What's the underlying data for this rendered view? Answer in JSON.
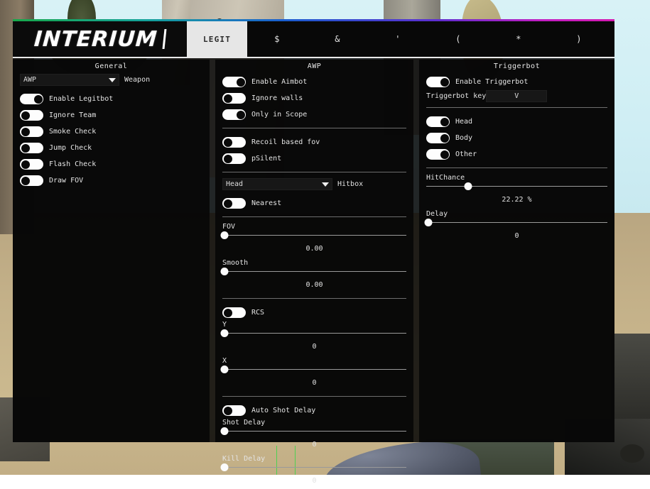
{
  "window": {
    "logo": "INTERIUM",
    "accent_gradient": [
      "#18a84a",
      "#16a39b",
      "#1a5fd0",
      "#5c2fd0",
      "#c21fc2"
    ]
  },
  "tabs": [
    {
      "label": "LEGIT",
      "active": true
    },
    {
      "label": "$",
      "active": false
    },
    {
      "label": "&",
      "active": false
    },
    {
      "label": "'",
      "active": false
    },
    {
      "label": "(",
      "active": false
    },
    {
      "label": "*",
      "active": false
    },
    {
      "label": ")",
      "active": false
    }
  ],
  "general": {
    "title": "General",
    "weapon_dropdown": {
      "value": "AWP",
      "label": "Weapon",
      "caret": "chevron-down-icon"
    },
    "toggles": [
      {
        "label": "Enable Legitbot",
        "on": true
      },
      {
        "label": "Ignore Team",
        "on": false
      },
      {
        "label": "Smoke Check",
        "on": false
      },
      {
        "label": "Jump Check",
        "on": false
      },
      {
        "label": "Flash Check",
        "on": false
      },
      {
        "label": "Draw FOV",
        "on": false
      }
    ]
  },
  "aimbot": {
    "title": "AWP",
    "toggles_top": [
      {
        "label": "Enable Aimbot",
        "on": true
      },
      {
        "label": "Ignore walls",
        "on": false
      },
      {
        "label": "Only in Scope",
        "on": true
      }
    ],
    "toggles_mid": [
      {
        "label": "Recoil based fov",
        "on": false
      },
      {
        "label": "pSilent",
        "on": false
      }
    ],
    "hitbox_dropdown": {
      "value": "Head",
      "label": "Hitbox",
      "caret": "chevron-down-icon"
    },
    "nearest_toggle": {
      "label": "Nearest",
      "on": false
    },
    "sliders_a": [
      {
        "label": "FOV",
        "value": "0.00",
        "pct": 1
      },
      {
        "label": "Smooth",
        "value": "0.00",
        "pct": 1
      }
    ],
    "rcs_toggle": {
      "label": "RCS",
      "on": false
    },
    "sliders_b": [
      {
        "label": "Y",
        "value": "0",
        "pct": 1
      },
      {
        "label": "X",
        "value": "0",
        "pct": 1
      }
    ],
    "auto_shot_delay_toggle": {
      "label": "Auto Shot Delay",
      "on": false
    },
    "sliders_c": [
      {
        "label": "Shot Delay",
        "value": "0",
        "pct": 1
      },
      {
        "label": "Kill Delay",
        "value": "0",
        "pct": 1
      }
    ]
  },
  "triggerbot": {
    "title": "Triggerbot",
    "enable_toggle": {
      "label": "Enable Triggerbot",
      "on": true
    },
    "keybind": {
      "label": "Triggerbot key",
      "key": "V"
    },
    "hitbox_toggles": [
      {
        "label": "Head",
        "on": true
      },
      {
        "label": "Body",
        "on": true
      },
      {
        "label": "Other",
        "on": true
      }
    ],
    "sliders": [
      {
        "label": "HitChance",
        "value": "22.22 %",
        "pct": 23
      },
      {
        "label": "Delay",
        "value": "0",
        "pct": 1
      }
    ]
  }
}
